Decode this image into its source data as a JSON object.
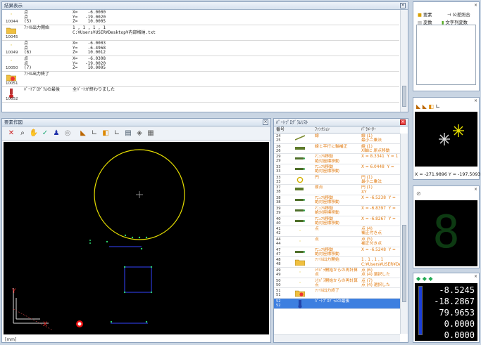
{
  "log": {
    "title": "結果表示",
    "entries": [
      {
        "num": "10044",
        "icon": "point-icon",
        "c1": "点\n点\n(5)",
        "c2": "X=    -6.0000\nY=   -19.0020\nZ=    10.0005"
      },
      {
        "num": "10045",
        "icon": "folder-icon",
        "c1": "ﾌｧｲﾙ出力開始",
        "c2": "1 , 1 , 1 , 1\nC:¥Users¥USER¥Desktop¥内部格納.txt"
      },
      {
        "num": "10049",
        "icon": "point-icon",
        "c1": "点\n点\n(6)",
        "c2": "X=    -6.0003\nY=    -6.4968\nZ=    10.0012"
      },
      {
        "num": "10050",
        "icon": "point-icon",
        "c1": "点\n点\n(7)",
        "c2": "X=    -6.0308\nY=   -19.0020\nZ=    10.0005"
      },
      {
        "num": "10051",
        "icon": "folder-end-icon",
        "c1": "ﾌｧｲﾙ出力終了",
        "c2": ""
      },
      {
        "num": "10052",
        "icon": "end-icon",
        "c1": "ﾊﾟｰﾄﾌﾟﾛｸﾞﾗﾑの最後",
        "c2": "全ﾊﾟｰﾄが終わりました"
      }
    ]
  },
  "drawing": {
    "title": "要素作図",
    "unit": "[mm]"
  },
  "program": {
    "title": "ﾊﾟｰﾄﾌﾟﾛｸﾞﾗﾑﾘｽﾄ",
    "headers": {
      "num": "番号",
      "func": "ﾌｧﾝｸｼｮﾝ",
      "param": "ﾊﾟﾗﾒｰﾀｰ"
    },
    "rows": [
      {
        "n": "24\n25",
        "icon": "line-icon",
        "fn": "線",
        "pa": "線 (1)\n最小二乗法"
      },
      {
        "n": "26\n26",
        "icon": "coord-icon",
        "fn": "線と平行に軸補正",
        "pa": "線 (1)\nX軸に 原点移動"
      },
      {
        "n": "29\n29",
        "icon": "probe-icon",
        "fn": "ﾏﾆｭｱﾙ移動\n絶対座標移動",
        "pa": "X = 8.3341  Y = 1"
      },
      {
        "n": "33\n33",
        "icon": "probe-icon",
        "fn": "ﾏﾆｭｱﾙ移動\n絶対座標移動",
        "pa": "X = 6.0448  Y ="
      },
      {
        "n": "33\n33",
        "icon": "circle-icon",
        "fn": "円",
        "pa": "円 (1)\n最小二乗法"
      },
      {
        "n": "37\n38",
        "icon": "origin-icon",
        "fn": "原点",
        "pa": "円 (1)\nXY"
      },
      {
        "n": "38\n38",
        "icon": "probe-icon",
        "fn": "ﾏﾆｭｱﾙ移動\n絶対座標移動",
        "pa": "X = -6.5238  Y ="
      },
      {
        "n": "39\n39",
        "icon": "probe-icon",
        "fn": "ﾏﾆｭｱﾙ移動\n絶対座標移動",
        "pa": "X = -6.8397  Y ="
      },
      {
        "n": "40\n40",
        "icon": "probe-icon",
        "fn": "ﾏﾆｭｱﾙ移動\n絶対座標移動",
        "pa": "X = -6.8267  Y ="
      },
      {
        "n": "41\n42",
        "icon": "point-icon",
        "fn": "点",
        "pa": "点 (4)\n補正付き点"
      },
      {
        "n": "44\n44",
        "icon": "point-icon",
        "fn": "点",
        "pa": "点 (5)\n補正付き点"
      },
      {
        "n": "47\n47",
        "icon": "probe-icon",
        "fn": "ﾏﾆｭｱﾙ移動\n絶対座標移動",
        "pa": "X = -6.5248  Y ="
      },
      {
        "n": "48\n48",
        "icon": "folder-icon",
        "fn": "ﾌｧｲﾙ出力開始",
        "pa": "1 , 1 , 1 , 1\nC:¥Users¥USER¥Desk"
      },
      {
        "n": "49\n49",
        "icon": "point-icon",
        "fn": "ｼﾘﾊﾟﾗ開始からの再計算\n点",
        "pa": "点 (6)\n点 (4) 選択した"
      },
      {
        "n": "50\n50",
        "icon": "point-icon",
        "fn": "ｼﾘﾊﾟﾗ開始からの再計算\n点",
        "pa": "点 (7)\n点 (4) 選択した"
      },
      {
        "n": "51\n51",
        "icon": "folder-end-icon",
        "fn": "ﾌｧｲﾙ出力終了",
        "pa": ""
      },
      {
        "n": "52\n52",
        "icon": "end-icon",
        "fn": "ﾊﾟｰﾄﾌﾟﾛｸﾞﾗﾑの最後",
        "pa": ""
      }
    ]
  },
  "right": {
    "tabs": [
      "要素",
      "公差照合",
      "変数",
      "文字列変数"
    ],
    "coords": "X = -271.9896  Y = -197.5093",
    "segment_digit": "8",
    "readouts": [
      "-8.5245",
      "-18.2867",
      "79.9653",
      "0.0000",
      "0.0000"
    ]
  }
}
